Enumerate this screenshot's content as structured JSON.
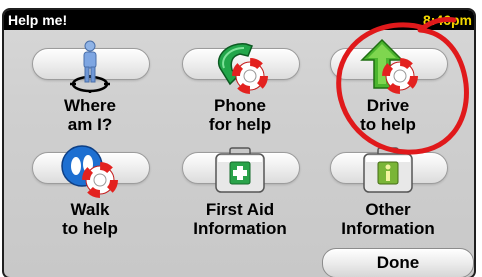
{
  "status": {
    "title": "Help me!",
    "time": "8:46pm"
  },
  "tiles": [
    {
      "label": "Where\nam I?",
      "icon": "person-location-icon"
    },
    {
      "label": "Phone\nfor help",
      "icon": "phone-lifebuoy-icon"
    },
    {
      "label": "Drive\nto help",
      "icon": "drive-arrow-lifebuoy-icon"
    },
    {
      "label": "Walk\nto help",
      "icon": "footsteps-lifebuoy-icon"
    },
    {
      "label": "First Aid\nInformation",
      "icon": "first-aid-kit-icon"
    },
    {
      "label": "Other\nInformation",
      "icon": "info-kit-icon"
    }
  ],
  "done_label": "Done",
  "colors": {
    "status_bg": "#000000",
    "time_color": "#f2d600",
    "annotation": "#e0191b",
    "first_aid_green": "#2aa34a",
    "phone_green": "#23a84a",
    "walk_blue": "#1d6fd1"
  }
}
